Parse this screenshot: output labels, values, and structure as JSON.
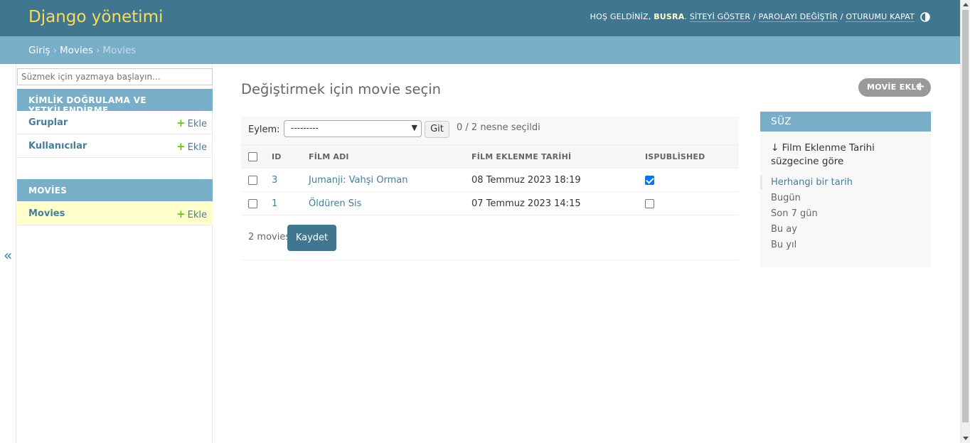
{
  "header": {
    "branding": "Django yönetimi",
    "welcome": "HOŞ GELDİNİZ,",
    "username": "BUSRA",
    "view_site": "SİTEYİ GÖSTER",
    "change_password": "PAROLAYI DEĞİŞTİR",
    "logout": "OTURUMU KAPAT"
  },
  "breadcrumbs": {
    "home": "Giriş",
    "app": "Movies",
    "current": "Movies"
  },
  "sidebar": {
    "filter_placeholder": "Süzmek için yazmaya başlayın...",
    "toggle": "«",
    "modules": [
      {
        "caption": "KİMLİK DOĞRULAMA VE YETKİLENDİRME",
        "items": [
          {
            "name": "Gruplar",
            "add": "Ekle"
          },
          {
            "name": "Kullanıcılar",
            "add": "Ekle"
          }
        ]
      },
      {
        "caption": "MOVİES",
        "items": [
          {
            "name": "Movies",
            "add": "Ekle"
          }
        ]
      }
    ]
  },
  "main": {
    "title": "Değiştirmek için movie seçin",
    "add_button": "MOVİE EKLE",
    "actions": {
      "label": "Eylem:",
      "selected": "---------",
      "go": "Git",
      "counter": "0 / 2 nesne seçildi"
    },
    "table": {
      "headers": [
        "ID",
        "FİLM ADI",
        "FİLM EKLENME TARİHİ",
        "ISPUBLİSHED"
      ],
      "rows": [
        {
          "id": "3",
          "name": "Jumanji: Vahşi Orman",
          "date": "08 Temmuz 2023 18:19",
          "published": true
        },
        {
          "id": "1",
          "name": "Öldüren Sis",
          "date": "07 Temmuz 2023 14:15",
          "published": false
        }
      ]
    },
    "paginator": {
      "count": "2 movies",
      "save": "Kaydet"
    }
  },
  "filter": {
    "title": "SÜZ",
    "heading": "↓ Film Eklenme Tarihi süzgecine göre",
    "options": [
      "Herhangi bir tarih",
      "Bugün",
      "Son 7 gün",
      "Bu ay",
      "Bu yıl"
    ],
    "selected_index": 0
  },
  "colors": {
    "header_bg": "#417690",
    "breadcrumb_bg": "#79aec8",
    "branding": "#f5dd5d",
    "link": "#447e9b",
    "add_green": "#70bf2b",
    "active_row": "#ffffcc"
  }
}
